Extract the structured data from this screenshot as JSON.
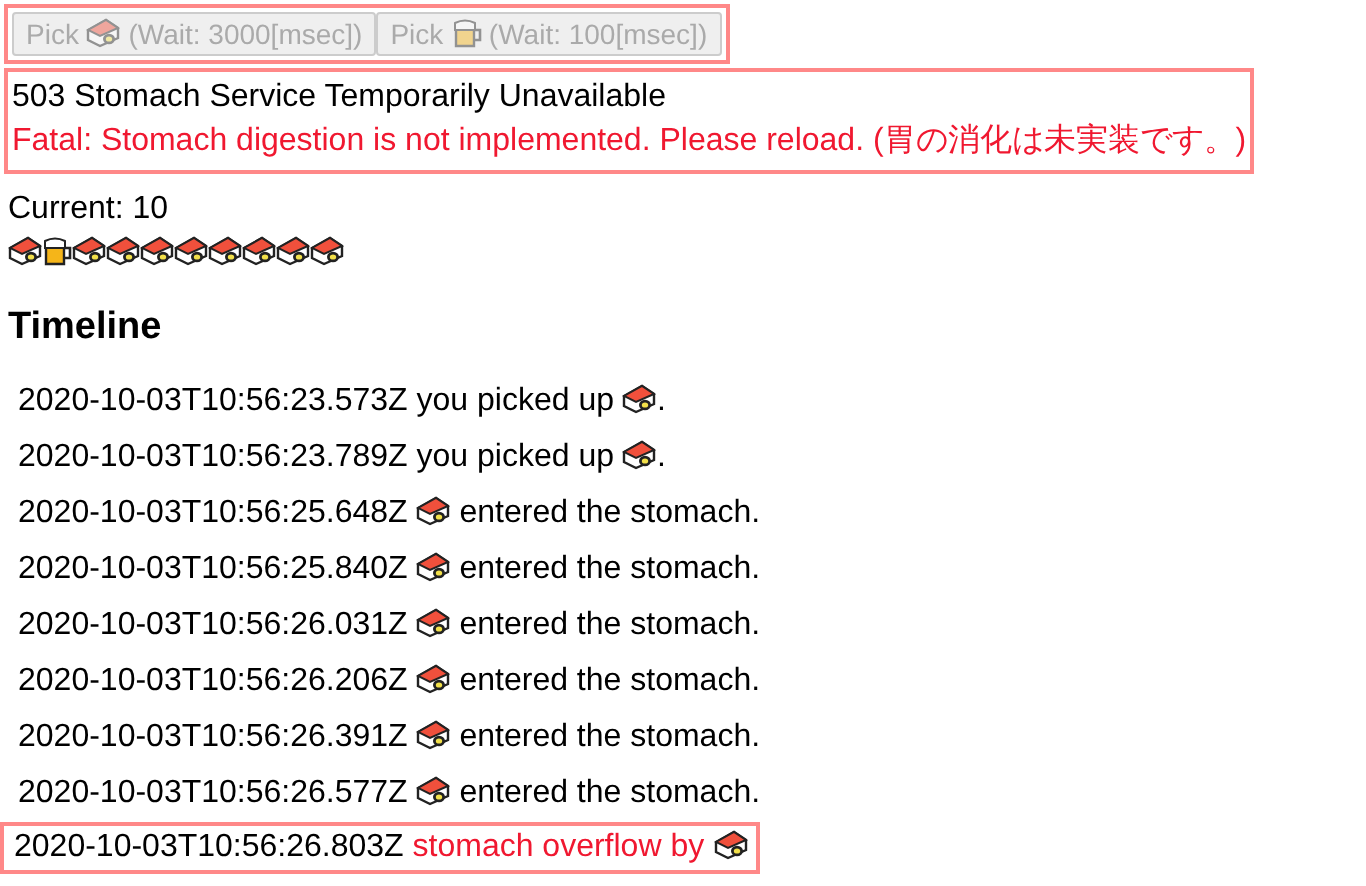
{
  "buttons": [
    {
      "label": "Pick",
      "food": {
        "kind": "sushi"
      },
      "wait": "(Wait: 3000[msec])",
      "disabled": true
    },
    {
      "label": "Pick",
      "food": {
        "kind": "beer"
      },
      "wait": "(Wait: 100[msec])",
      "disabled": true
    }
  ],
  "error": {
    "status": "503 Stomach Service Temporarily Unavailable",
    "message": "Fatal: Stomach digestion is not implemented. Please reload. (胃の消化は未実装です。)"
  },
  "current": "Current: 10",
  "stomach": [
    {
      "kind": "sushi"
    },
    {
      "kind": "beer"
    },
    {
      "kind": "sushi"
    },
    {
      "kind": "sushi"
    },
    {
      "kind": "sushi"
    },
    {
      "kind": "sushi"
    },
    {
      "kind": "sushi"
    },
    {
      "kind": "sushi"
    },
    {
      "kind": "sushi"
    },
    {
      "kind": "sushi"
    }
  ],
  "timeline": {
    "title": "Timeline",
    "entries": [
      {
        "kind": "pick",
        "time": "2020-10-03T10:56:23.573Z",
        "text": "you picked up",
        "food": {
          "kind": "sushi"
        },
        "suffix": "."
      },
      {
        "kind": "pick",
        "time": "2020-10-03T10:56:23.789Z",
        "text": "you picked up",
        "food": {
          "kind": "sushi"
        },
        "suffix": "."
      },
      {
        "kind": "enter",
        "time": "2020-10-03T10:56:25.648Z",
        "text": "entered the stomach.",
        "food": {
          "kind": "sushi"
        }
      },
      {
        "kind": "enter",
        "time": "2020-10-03T10:56:25.840Z",
        "text": "entered the stomach.",
        "food": {
          "kind": "sushi"
        }
      },
      {
        "kind": "enter",
        "time": "2020-10-03T10:56:26.031Z",
        "text": "entered the stomach.",
        "food": {
          "kind": "sushi"
        }
      },
      {
        "kind": "enter",
        "time": "2020-10-03T10:56:26.206Z",
        "text": "entered the stomach.",
        "food": {
          "kind": "sushi"
        }
      },
      {
        "kind": "enter",
        "time": "2020-10-03T10:56:26.391Z",
        "text": "entered the stomach.",
        "food": {
          "kind": "sushi"
        }
      },
      {
        "kind": "enter",
        "time": "2020-10-03T10:56:26.577Z",
        "text": "entered the stomach.",
        "food": {
          "kind": "sushi"
        }
      },
      {
        "kind": "overflow",
        "time": "2020-10-03T10:56:26.803Z",
        "text": "stomach overflow by",
        "food": {
          "kind": "sushi"
        }
      }
    ]
  }
}
